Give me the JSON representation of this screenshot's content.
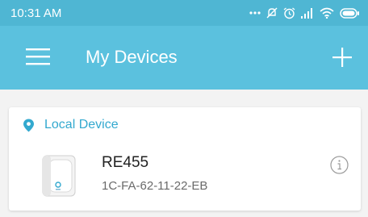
{
  "status_bar": {
    "time": "10:31 AM",
    "icons": [
      "more-dots-icon",
      "mute-icon",
      "alarm-icon",
      "signal-icon",
      "wifi-icon",
      "battery-icon"
    ]
  },
  "app_bar": {
    "title": "My Devices",
    "menu_icon": "hamburger-menu-icon",
    "add_icon": "plus-icon"
  },
  "section": {
    "label": "Local Device",
    "icon": "location-pin-icon"
  },
  "devices": [
    {
      "name": "RE455",
      "mac": "1C-FA-62-11-22-EB",
      "icon": "range-extender-icon",
      "info_icon": "info-icon"
    }
  ],
  "colors": {
    "status_bar": "#4fb6d3",
    "app_bar": "#5bc1de",
    "accent": "#33a9cf",
    "background": "#f3f3f3",
    "card": "#ffffff"
  }
}
